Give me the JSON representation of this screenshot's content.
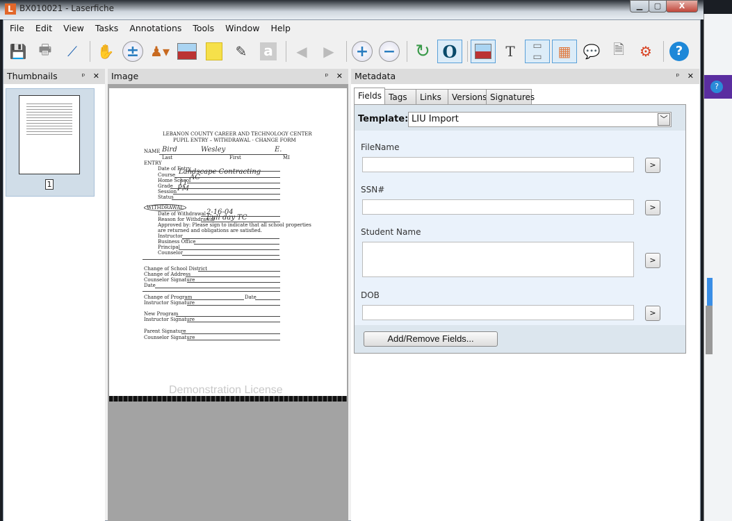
{
  "window": {
    "title": "BX010021 - Laserfiche",
    "app_icon": "L",
    "min": "▁",
    "max": "▢",
    "close": "X"
  },
  "menu": [
    "File",
    "Edit",
    "View",
    "Tasks",
    "Annotations",
    "Tools",
    "Window",
    "Help"
  ],
  "toolbar": [
    "save-icon",
    "print-icon",
    "scan-icon",
    "pan-hand-icon",
    "zoom-tool-icon",
    "stamp-icon",
    "image-icon",
    "sticky-note-icon",
    "highlighter-icon",
    "text-annotation-icon",
    "previous-page-icon",
    "next-page-icon",
    "zoom-in-icon",
    "zoom-out-icon",
    "rotate-icon",
    "ocr-icon",
    "image-view-icon",
    "text-view-icon",
    "fields-pane-icon",
    "thumbnails-pane-icon",
    "annotations-pane-icon",
    "document-pane-icon",
    "settings-icon",
    "help-icon"
  ],
  "panels": {
    "thumbnails": "Thumbnails",
    "image": "Image",
    "metadata": "Metadata",
    "pin_close": "ᵖ ✕"
  },
  "thumbnail": {
    "page_number": "1"
  },
  "document": {
    "header1": "LEBANON COUNTY CAREER AND TECHNOLOGY CENTER",
    "header2": "PUPIL ENTRY – WITHDRAWAL  - CHANGE FORM",
    "name_label": "NAME",
    "last": "Last",
    "first": "First",
    "mi": "MI",
    "hw_last": "Bird",
    "hw_first": "Wesley",
    "hw_mi": "E.",
    "entry": "ENTRY",
    "entry_fields": [
      "Date of Entry",
      "Course",
      "Home School",
      "Grade",
      "Session",
      "Status"
    ],
    "hw_course": "Landscape Contracting",
    "hw_home": "AC",
    "hw_grade": "11",
    "hw_session": "PM",
    "withdrawal": "WITHDRAWAL",
    "date_withdrawal": "Date of Withdrawal",
    "hw_date": "2-16-04",
    "reason": "Reason for Withdrawal",
    "hw_reason": "Full day TC",
    "approved1": "Approved by:  Please sign to indicate that all school properties",
    "approved2": "are returned and obligations are satisfied.",
    "sign_fields": [
      "Instructor",
      "Business Office",
      "Principal",
      "Counselor"
    ],
    "change_fields": [
      "Change of School District",
      "Change of Address",
      "Counselor Signature",
      "Date"
    ],
    "program": "Change of Program",
    "date": "Date",
    "instructor_sig": "Instructor Signature",
    "new_program": "New Program",
    "instructor_sig2": "Instructor Signature",
    "parent_sig": "Parent Signature",
    "counselor_sig": "Counselor Signature",
    "watermark": "Demonstration License"
  },
  "metadata": {
    "tabs": [
      "Fields",
      "Tags",
      "Links",
      "Versions",
      "Signatures"
    ],
    "template_label": "Template:",
    "template_value": "LIU Import",
    "fields": [
      {
        "label": "FileName",
        "value": ""
      },
      {
        "label": "SSN#",
        "value": ""
      },
      {
        "label": "Student Name",
        "value": ""
      },
      {
        "label": "DOB",
        "value": ""
      }
    ],
    "field_button": ">",
    "add_remove": "Add/Remove Fields..."
  }
}
